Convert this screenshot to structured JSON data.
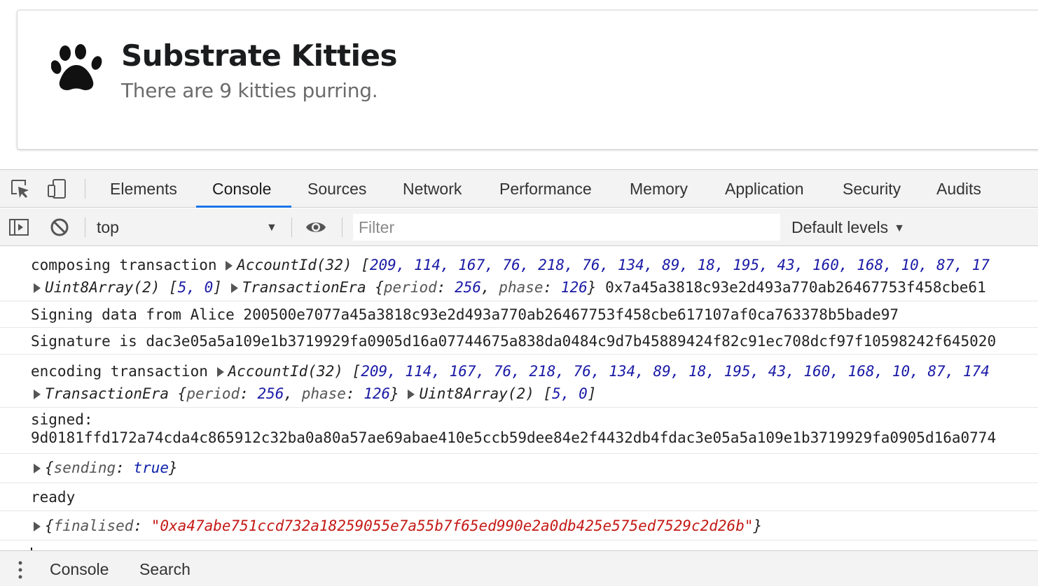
{
  "app": {
    "title": "Substrate Kitties",
    "subtitle": "There are 9 kitties purring."
  },
  "devtools": {
    "tabs": [
      "Elements",
      "Console",
      "Sources",
      "Network",
      "Performance",
      "Memory",
      "Application",
      "Security",
      "Audits"
    ],
    "active_tab": "Console",
    "context": "top",
    "filter_placeholder": "Filter",
    "levels_label": "Default levels",
    "accent_color": "#1a73e8",
    "drawer_tabs": [
      "Console",
      "Search"
    ]
  },
  "console": {
    "msg1": {
      "text": "composing transaction",
      "account_type": "AccountId(32)",
      "account_values": "209, 114, 167, 76, 218, 76, 134, 89, 18, 195, 43, 160, 168, 10, 87, 17",
      "uint_type": "Uint8Array(2)",
      "uint_values": "5, 0",
      "era_type": "TransactionEra",
      "era_period_key": "period",
      "era_period": "256",
      "era_phase_key": "phase",
      "era_phase": "126",
      "hash_tail": "0x7a45a3818c93e2d493a770ab26467753f458cbe61"
    },
    "msg2": "Signing data from Alice 200500e7077a45a3818c93e2d493a770ab26467753f458cbe617107af0ca763378b5bade97",
    "msg3": "Signature is dac3e05a5a109e1b3719929fa0905d16a07744675a838da0484c9d7b45889424f82c91ec708dcf97f10598242f645020",
    "msg4": {
      "text": "encoding transaction",
      "account_type": "AccountId(32)",
      "account_values": "209, 114, 167, 76, 218, 76, 134, 89, 18, 195, 43, 160, 168, 10, 87, 174",
      "era_type": "TransactionEra",
      "era_period": "256",
      "era_phase": "126",
      "uint_type": "Uint8Array(2)",
      "uint_values": "5, 0"
    },
    "msg5": {
      "label": "signed:",
      "value": "9d0181ffd172a74cda4c865912c32ba0a80a57ae69abae410e5ccb59dee84e2f4432db4fdac3e05a5a109e1b3719929fa0905d16a0774"
    },
    "msg6": {
      "key": "sending",
      "value": "true"
    },
    "msg7": "ready",
    "msg8": {
      "key": "finalised",
      "value": "\"0xa47abe751ccd732a18259055e7a55b7f65ed990e2a0db425e575ed7529c2d26b\""
    }
  }
}
